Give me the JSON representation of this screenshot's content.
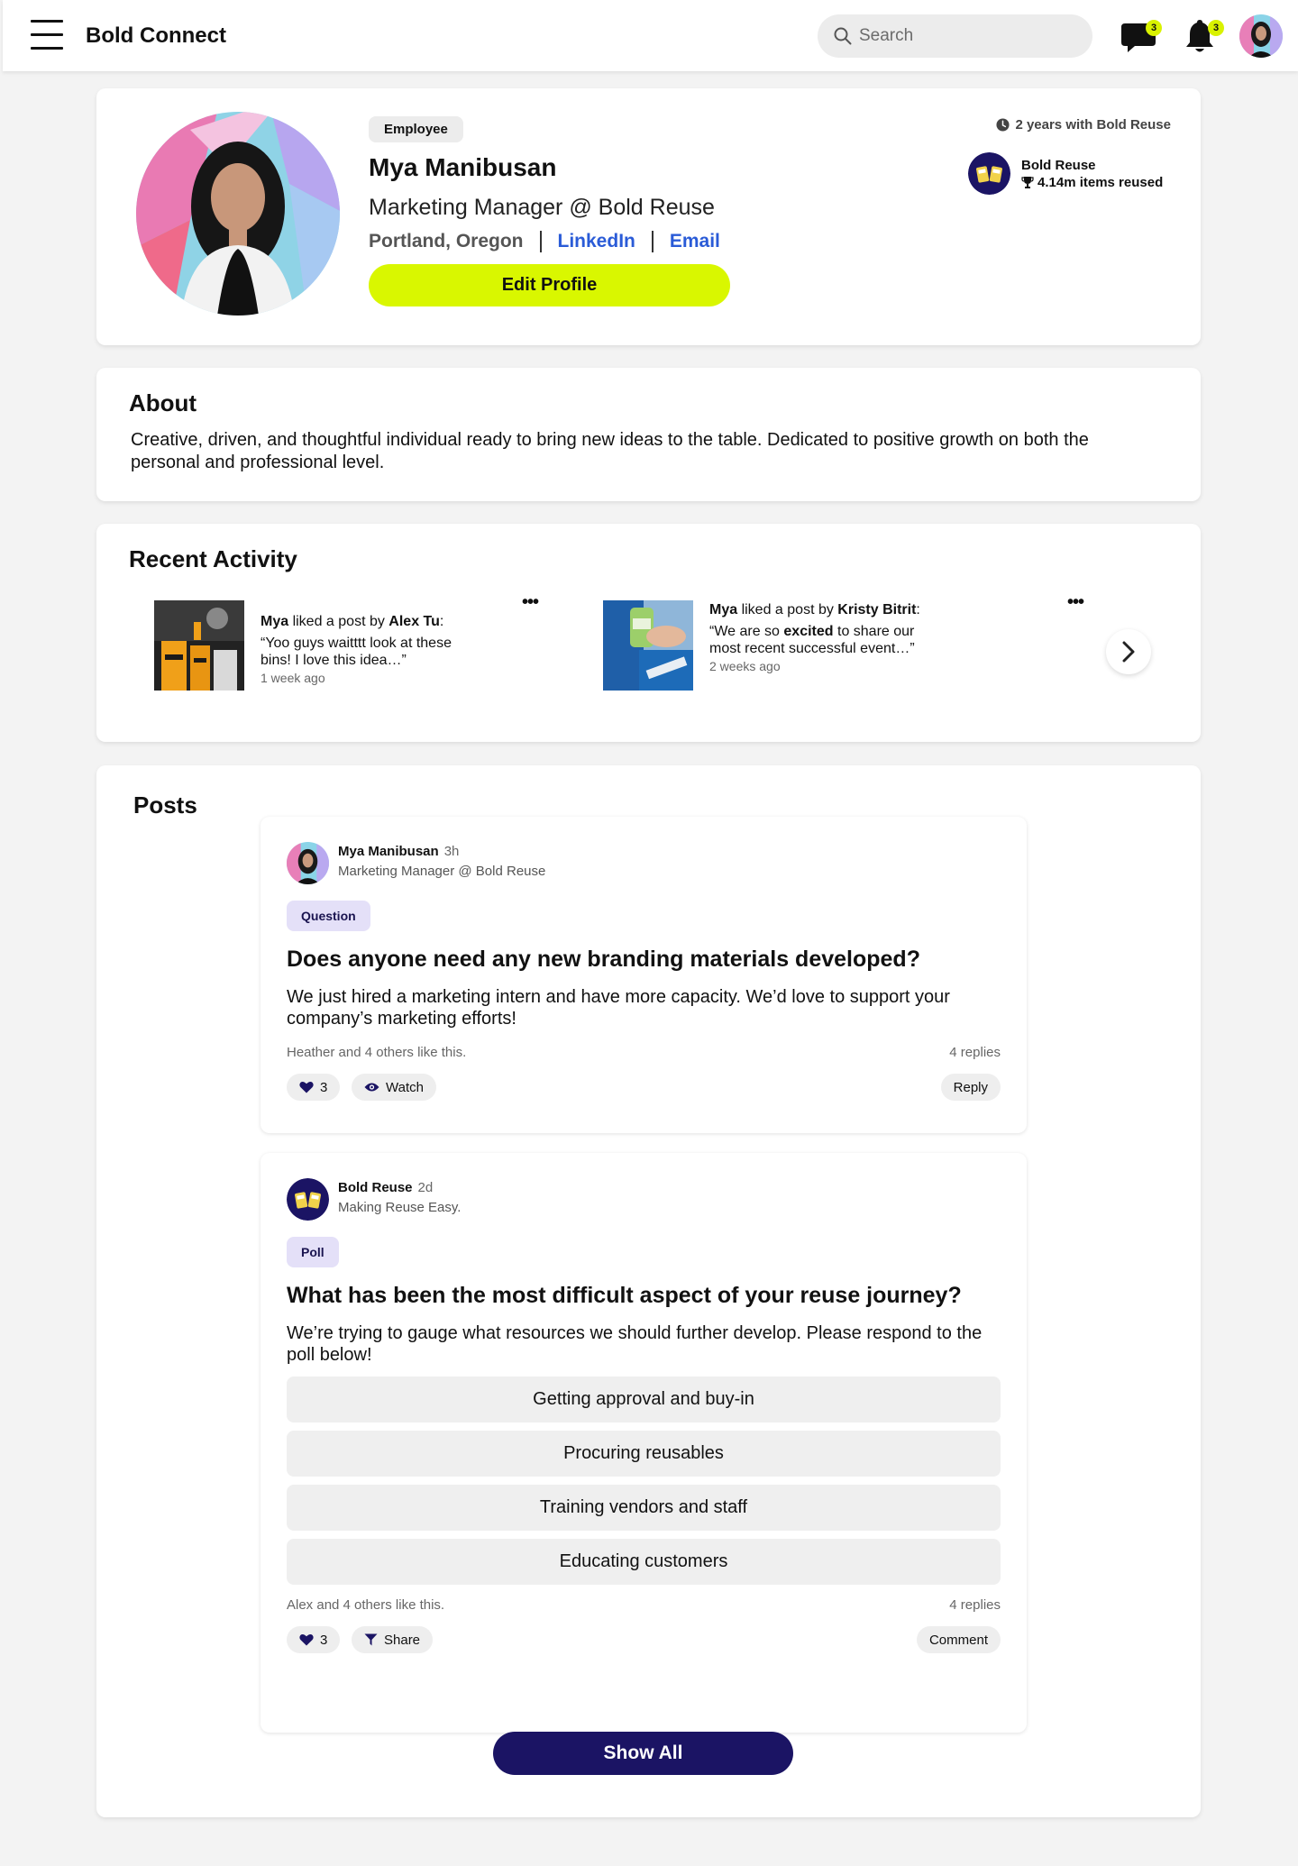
{
  "app": {
    "brand": "Bold Connect"
  },
  "header": {
    "search_placeholder": "Search",
    "messages_badge": "3",
    "notifications_badge": "3"
  },
  "profile": {
    "badge": "Employee",
    "name": "Mya Manibusan",
    "title": "Marketing Manager @ Bold Reuse",
    "location": "Portland, Oregon",
    "linkedin": "LinkedIn",
    "email": "Email",
    "edit_button": "Edit Profile",
    "tenure": "2 years with Bold Reuse",
    "org_name": "Bold Reuse",
    "org_stat": "4.14m items reused"
  },
  "about": {
    "heading": "About",
    "text": "Creative, driven, and thoughtful individual ready to bring new ideas to the table. Dedicated to positive growth on both the personal and professional level."
  },
  "activity": {
    "heading": "Recent Activity",
    "items": [
      {
        "actor": "Mya",
        "action": " liked a post by ",
        "target": "Alex Tu",
        "colon": ":",
        "quote": "“Yoo guys waitttt look at these bins! I love this idea…”",
        "time": "1 week ago"
      },
      {
        "actor": "Mya",
        "action": " liked a post by ",
        "target": "Kristy Bitrit",
        "colon": ":",
        "quote_pre": "“We are so ",
        "quote_bold": "excited",
        "quote_post": " to share our most recent successful event…”",
        "time": "2 weeks ago"
      }
    ]
  },
  "posts": {
    "heading": "Posts",
    "items": [
      {
        "author": "Mya Manibusan",
        "time": "3h",
        "subtitle": "Marketing Manager @ Bold Reuse",
        "tag": "Question",
        "question": "Does anyone need any new branding materials developed?",
        "text": "We just hired a marketing intern and have more capacity. We’d love to support your company’s marketing efforts!",
        "likes_text": "Heather and 4 others like this.",
        "replies": "4 replies",
        "like_count": "3",
        "secondary_action": "Watch",
        "primary_action": "Reply"
      },
      {
        "author": "Bold Reuse",
        "time": "2d",
        "subtitle": "Making Reuse Easy.",
        "tag": "Poll",
        "question": "What has been the most difficult aspect of your reuse journey?",
        "text": "We’re trying to gauge what resources we should further develop. Please respond to the poll below!",
        "poll_options": [
          "Getting approval and buy-in",
          "Procuring reusables",
          "Training vendors and staff",
          "Educating customers"
        ],
        "likes_text": "Alex and 4 others like this.",
        "replies": "4 replies",
        "like_count": "3",
        "secondary_action": "Share",
        "primary_action": "Comment"
      }
    ],
    "show_all": "Show All"
  },
  "colors": {
    "accent_lime": "#d9f700",
    "navy": "#1b1464",
    "link_blue": "#2a5bd7",
    "tag_bg": "#e4e0f8"
  }
}
